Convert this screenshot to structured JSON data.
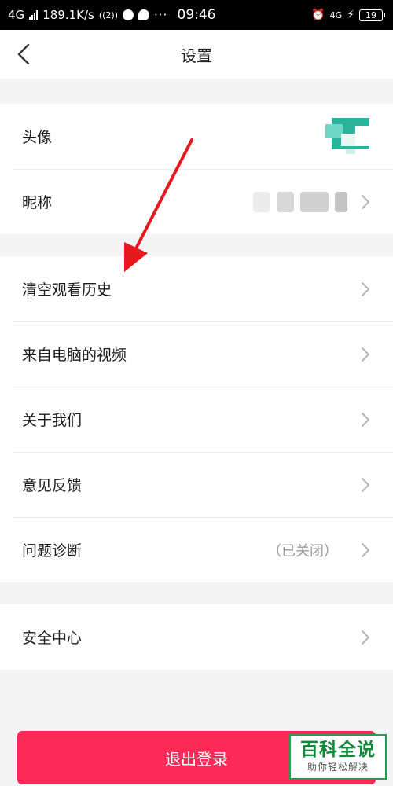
{
  "status_bar": {
    "network": "4G",
    "speed": "189.1K/s",
    "time": "09:46",
    "right_network": "4G",
    "battery": "19",
    "icons": [
      "signal-icon",
      "wifi-calling-icon",
      "app-notification-icon",
      "chat-icon",
      "more-dots-icon",
      "alarm-icon",
      "data-icon",
      "charging-icon",
      "battery-icon"
    ]
  },
  "nav": {
    "title": "设置",
    "back_icon": "back-chevron-icon"
  },
  "profile_group": [
    {
      "label": "头像"
    },
    {
      "label": "昵称"
    }
  ],
  "settings_group": [
    {
      "label": "清空观看历史"
    },
    {
      "label": "来自电脑的视频"
    },
    {
      "label": "关于我们"
    },
    {
      "label": "意见反馈"
    },
    {
      "label": "问题诊断",
      "value": "（已关闭）"
    }
  ],
  "security_group": [
    {
      "label": "安全中心"
    }
  ],
  "logout_label": "退出登录",
  "annotation": {
    "type": "red-arrow",
    "color": "#e8191e"
  },
  "watermark": {
    "main": "百科全说",
    "sub": "助你轻松解决"
  },
  "colors": {
    "accent": "#ff2a58",
    "background": "#f4f4f6",
    "watermark_green": "#0e8a3a"
  }
}
